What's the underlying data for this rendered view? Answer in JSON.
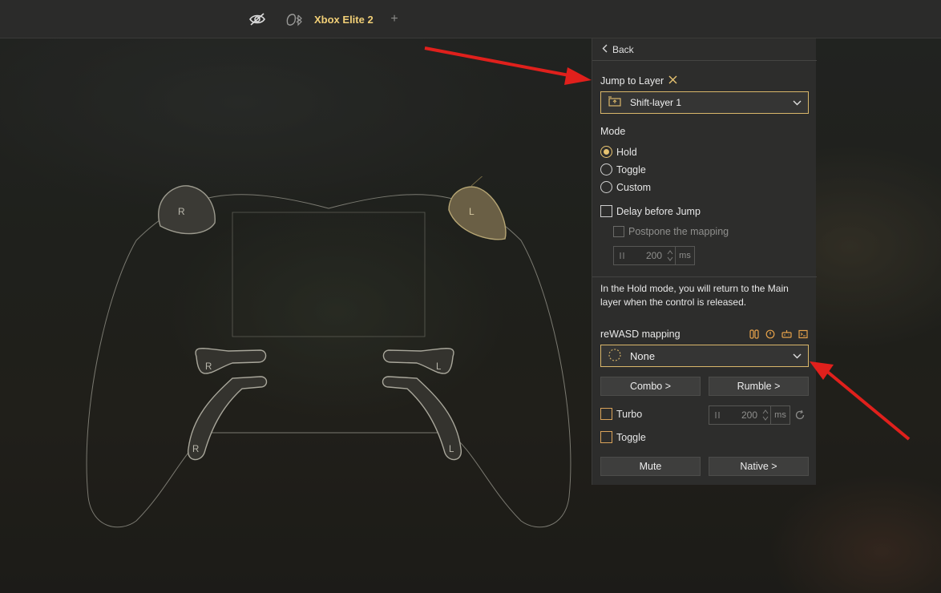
{
  "topbar": {
    "device_name": "Xbox Elite 2",
    "add_tab_symbol": "+"
  },
  "controller": {
    "bumper_right": "R",
    "bumper_left": "L",
    "paddle_upper_right": "R",
    "paddle_upper_left": "L",
    "paddle_lower_right": "R",
    "paddle_lower_left": "L"
  },
  "panel": {
    "back_label": "Back",
    "jump_to_layer_label": "Jump to Layer",
    "jump_to_layer_value": "Shift-layer 1",
    "mode_label": "Mode",
    "modes": [
      {
        "label": "Hold",
        "selected": true
      },
      {
        "label": "Toggle",
        "selected": false
      },
      {
        "label": "Custom",
        "selected": false
      }
    ],
    "delay_before_jump_label": "Delay before Jump",
    "postpone_label": "Postpone the mapping",
    "postpone_value": "200",
    "postpone_unit": "ms",
    "info_text": "In the Hold mode, you will return to the Main layer when the control is released.",
    "mapping_label": "reWASD mapping",
    "mapping_value": "None",
    "combo_label": "Combo >",
    "rumble_label": "Rumble >",
    "turbo_label": "Turbo",
    "turbo_value": "200",
    "turbo_unit": "ms",
    "toggle_label": "Toggle",
    "mute_label": "Mute",
    "native_label": "Native >"
  },
  "colors": {
    "accent": "#e7c371",
    "device_name": "#f1cf77",
    "panel_bg": "#2d2d2c",
    "annotation_arrow": "#e0201c"
  },
  "icons": [
    "eye-off-icon",
    "controller-bluetooth-icon",
    "chevron-left-icon",
    "close-icon",
    "layer-icon",
    "chevron-down-icon",
    "switch-icon",
    "clock-icon",
    "gamepad-icon",
    "terminal-icon",
    "dotted-circle-icon",
    "pause-grip-icon",
    "refresh-icon"
  ]
}
